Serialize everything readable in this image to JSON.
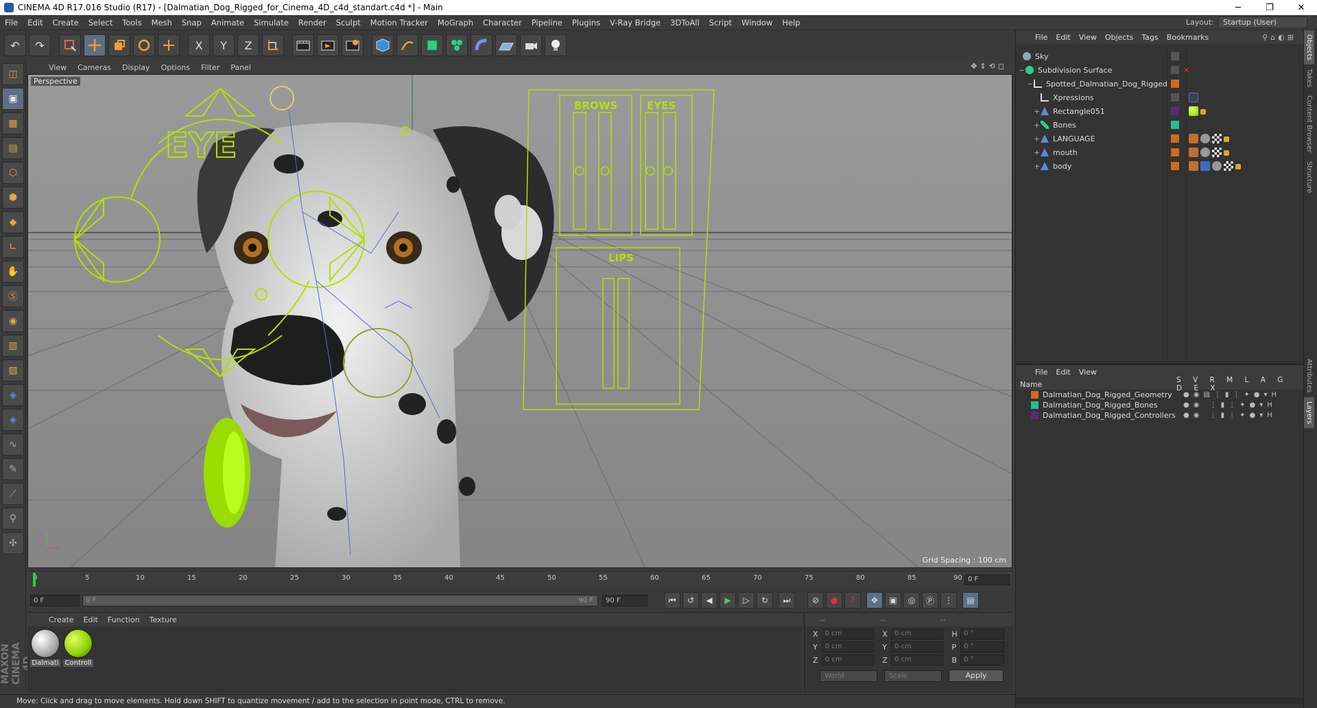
{
  "window": {
    "title": "CINEMA 4D R17.016 Studio (R17) - [Dalmatian_Dog_Rigged_for_Cinema_4D_c4d_standart.c4d *] - Main",
    "minimize": "─",
    "maximize": "❐",
    "close": "✕"
  },
  "menubar": {
    "items": [
      "File",
      "Edit",
      "Create",
      "Select",
      "Tools",
      "Mesh",
      "Snap",
      "Animate",
      "Simulate",
      "Render",
      "Sculpt",
      "Motion Tracker",
      "MoGraph",
      "Character",
      "Pipeline",
      "Plugins",
      "V-Ray Bridge",
      "3DToAll",
      "Script",
      "Window",
      "Help"
    ],
    "layout_label": "Layout:",
    "layout_value": "Startup (User)"
  },
  "toolbar": {
    "undo": "↶",
    "redo": "↷",
    "x": "X",
    "y": "Y",
    "z": "Z"
  },
  "viewport": {
    "menu": [
      "View",
      "Cameras",
      "Display",
      "Options",
      "Filter",
      "Panel"
    ],
    "label": "Perspective",
    "grid_spacing": "Grid Spacing : 100 cm",
    "hud": {
      "eye": "EYE",
      "brows": "BROWS",
      "eyes": "EYES",
      "lips": "LIPS"
    }
  },
  "timeline": {
    "ticks": [
      "0",
      "5",
      "10",
      "15",
      "20",
      "25",
      "30",
      "35",
      "40",
      "45",
      "50",
      "55",
      "60",
      "65",
      "70",
      "75",
      "80",
      "85",
      "90"
    ],
    "current_frame": "0 F"
  },
  "playbar": {
    "start": "0 F",
    "slider_start": "0 F",
    "slider_end": "90 F",
    "end": "90 F"
  },
  "materials": {
    "menu": [
      "Create",
      "Edit",
      "Function",
      "Texture"
    ],
    "items": [
      {
        "name": "Dalmati"
      },
      {
        "name": "Controll"
      }
    ]
  },
  "coords": {
    "headers": [
      "--",
      "--",
      "--"
    ],
    "rows": [
      {
        "a": "X",
        "av": "0 cm",
        "b": "X",
        "bv": "0 cm",
        "c": "H",
        "cv": "0 °"
      },
      {
        "a": "Y",
        "av": "0 cm",
        "b": "Y",
        "bv": "0 cm",
        "c": "P",
        "cv": "0 °"
      },
      {
        "a": "Z",
        "av": "0 cm",
        "b": "Z",
        "bv": "0 cm",
        "c": "B",
        "cv": "0 °"
      }
    ],
    "world": "World",
    "scale": "Scale",
    "apply": "Apply"
  },
  "status": "Move: Click and drag to move elements. Hold down SHIFT to quantize movement / add to the selection in point mode, CTRL to remove.",
  "objects": {
    "menu": [
      "File",
      "Edit",
      "View",
      "Objects",
      "Tags",
      "Bookmarks"
    ],
    "items": [
      {
        "name": "Sky",
        "color": "#9aa4b8"
      },
      {
        "name": "Subdivision Surface",
        "color": "#2ad08a"
      },
      {
        "name": "Spotted_Dalmatian_Dog_Rigged",
        "color": "#e8e8e8"
      },
      {
        "name": "Xpressions",
        "color": "#e8e8e8"
      },
      {
        "name": "Rectangle051",
        "color": "#5a8ad8"
      },
      {
        "name": "Bones",
        "color": "#2ad08a"
      },
      {
        "name": "LANGUAGE",
        "color": "#5a8ad8"
      },
      {
        "name": "mouth",
        "color": "#5a8ad8"
      },
      {
        "name": "body",
        "color": "#5a8ad8"
      }
    ]
  },
  "layers": {
    "menu": [
      "File",
      "Edit",
      "View"
    ],
    "name_header": "Name",
    "cols": "S V R M L A G D E X",
    "items": [
      {
        "name": "Dalmatian_Dog_Rigged_Geometry",
        "color": "#d2691e"
      },
      {
        "name": "Dalmatian_Dog_Rigged_Bones",
        "color": "#20c090"
      },
      {
        "name": "Dalmatian_Dog_Rigged_Controllers",
        "color": "#5a2a7a"
      }
    ]
  },
  "sidetabs": [
    "Objects",
    "Takes",
    "Content Browser",
    "Structure",
    "Attributes",
    "Layers"
  ]
}
